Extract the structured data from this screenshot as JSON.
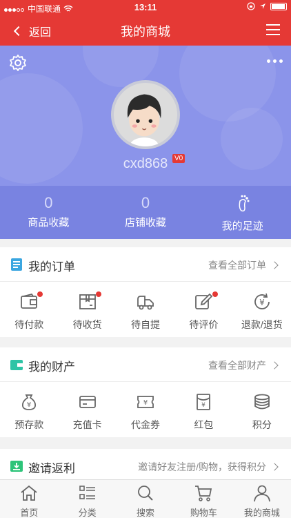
{
  "status_bar": {
    "carrier": "中国联通",
    "time": "13:11"
  },
  "nav": {
    "back_label": "返回",
    "title": "我的商城"
  },
  "profile": {
    "username": "cxd868",
    "level_badge": "V0",
    "stats": [
      {
        "value": "0",
        "label": "商品收藏"
      },
      {
        "value": "0",
        "label": "店铺收藏"
      },
      {
        "value": "",
        "label": "我的足迹"
      }
    ]
  },
  "orders": {
    "title": "我的订单",
    "link": "查看全部订单",
    "items": [
      {
        "label": "待付款",
        "icon": "wallet-icon",
        "dot": true
      },
      {
        "label": "待收货",
        "icon": "box-icon",
        "dot": true
      },
      {
        "label": "待自提",
        "icon": "truck-icon",
        "dot": false
      },
      {
        "label": "待评价",
        "icon": "edit-icon",
        "dot": true
      },
      {
        "label": "退款/退货",
        "icon": "refund-icon",
        "dot": false
      }
    ]
  },
  "assets": {
    "title": "我的财产",
    "link": "查看全部财产",
    "items": [
      {
        "label": "预存款",
        "icon": "moneybag-icon"
      },
      {
        "label": "充值卡",
        "icon": "card-icon"
      },
      {
        "label": "代金券",
        "icon": "voucher-icon"
      },
      {
        "label": "红包",
        "icon": "redpacket-icon"
      },
      {
        "label": "积分",
        "icon": "coins-icon"
      }
    ]
  },
  "invite": {
    "title": "邀请返利",
    "link": "邀请好友注册/购物，获得积分"
  },
  "tabs": [
    {
      "label": "首页",
      "icon": "home-icon"
    },
    {
      "label": "分类",
      "icon": "category-icon"
    },
    {
      "label": "搜索",
      "icon": "search-icon"
    },
    {
      "label": "购物车",
      "icon": "cart-icon"
    },
    {
      "label": "我的商城",
      "icon": "user-icon"
    }
  ],
  "colors": {
    "brand_red": "#e53935",
    "profile_bg": "#8b94ea",
    "order_icon": "#3aa6e0",
    "asset_icon": "#2ec4a6",
    "invite_icon": "#2ec47a"
  }
}
